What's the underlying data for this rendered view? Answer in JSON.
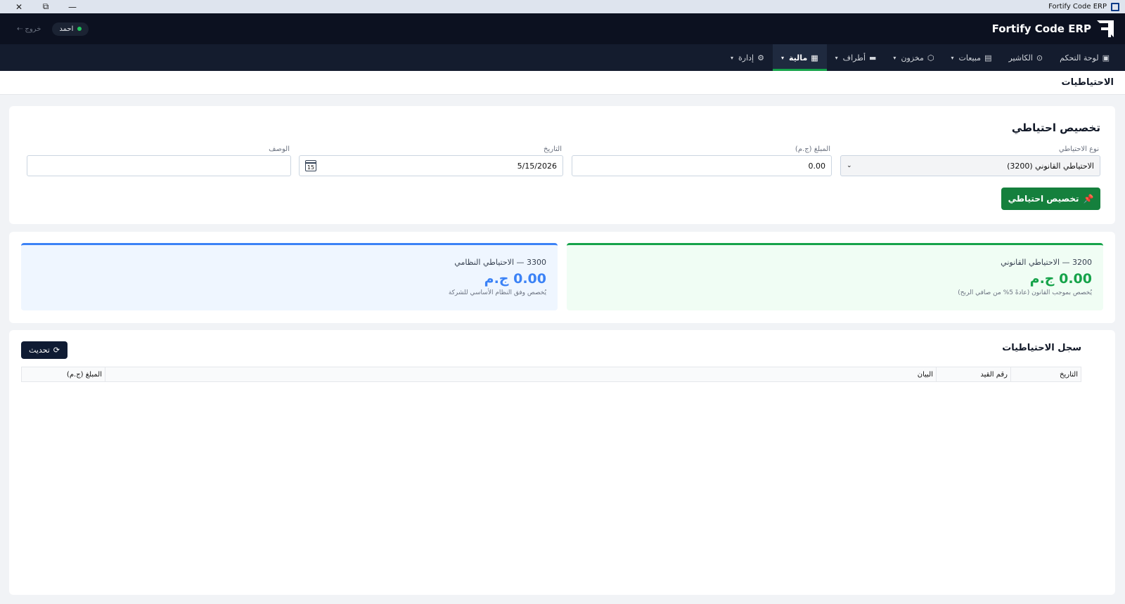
{
  "window": {
    "title": "Fortify Code ERP"
  },
  "header": {
    "brand": "Fortify Code ERP",
    "user_name": "احمد",
    "logout_label": "خروج"
  },
  "nav": [
    {
      "label": "لوحة التحكم",
      "icon": "dashboard-icon",
      "has_menu": false,
      "active": false
    },
    {
      "label": "الكاشير",
      "icon": "cashier-icon",
      "has_menu": false,
      "active": false
    },
    {
      "label": "مبيعات",
      "icon": "sales-icon",
      "has_menu": true,
      "active": false
    },
    {
      "label": "مخزون",
      "icon": "inventory-icon",
      "has_menu": true,
      "active": false
    },
    {
      "label": "أطراف",
      "icon": "parties-icon",
      "has_menu": true,
      "active": false
    },
    {
      "label": "مالية",
      "icon": "finance-icon",
      "has_menu": true,
      "active": true
    },
    {
      "label": "إدارة",
      "icon": "admin-gear-icon",
      "has_menu": true,
      "active": false
    }
  ],
  "page": {
    "title": "الاحتياطيات"
  },
  "form": {
    "title": "تخصيص احتياطي",
    "reserve_type_label": "نوع الاحتياطي",
    "reserve_type_value": "الاحتياطي القانوني (3200)",
    "amount_label": "المبلغ (ج.م)",
    "amount_value": "0.00",
    "date_label": "التاريخ",
    "date_value": "5/15/2026",
    "calendar_day": "15",
    "description_label": "الوصف",
    "description_value": "",
    "submit_label": "تخصيص احتياطي"
  },
  "summary": {
    "legal": {
      "name": "3200 — الاحتياطي القانوني",
      "amount": "0.00 ج.م",
      "note": "يُخصص بموجب القانون (عادةً 5% من صافي الربح)"
    },
    "statutory": {
      "name": "3300 — الاحتياطي النظامي",
      "amount": "0.00 ج.م",
      "note": "يُخصص وفق النظام الأساسي للشركة"
    }
  },
  "log": {
    "title": "سجل الاحتياطيات",
    "refresh_label": "تحديث",
    "columns": [
      "التاريخ",
      "رقم القيد",
      "البيان",
      "المبلغ (ج.م)"
    ],
    "rows": []
  },
  "colors": {
    "header_bg": "#0c1120",
    "nav_bg": "#141c2e",
    "accent_green": "#16a34a",
    "accent_blue": "#3b82f6"
  }
}
